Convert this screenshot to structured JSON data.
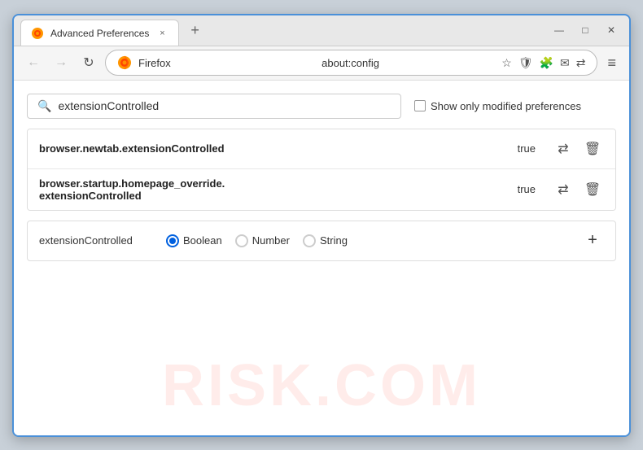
{
  "window": {
    "title": "Advanced Preferences",
    "tab_close": "×",
    "new_tab": "+",
    "minimize": "—",
    "maximize": "□",
    "close": "✕"
  },
  "nav": {
    "back": "←",
    "forward": "→",
    "reload": "↻",
    "browser_name": "Firefox",
    "url": "about:config",
    "star_icon": "☆",
    "shield_icon": "🛡",
    "ext_icon": "🧩",
    "mail_icon": "✉",
    "sync_icon": "⇄",
    "menu_icon": "≡"
  },
  "search": {
    "placeholder": "extensionControlled",
    "value": "extensionControlled",
    "show_modified_label": "Show only modified preferences",
    "show_modified_checked": false
  },
  "results": [
    {
      "name": "browser.newtab.extensionControlled",
      "value": "true"
    },
    {
      "name": "browser.startup.homepage_override.extensionControlled",
      "value": "true",
      "multiline": true
    }
  ],
  "add_row": {
    "name": "extensionControlled",
    "types": [
      "Boolean",
      "Number",
      "String"
    ],
    "selected_type": "Boolean",
    "add_label": "+"
  },
  "watermark": "RISK.COM",
  "icons": {
    "search": "🔍",
    "reset": "⇄",
    "delete": "🗑",
    "add": "+"
  }
}
